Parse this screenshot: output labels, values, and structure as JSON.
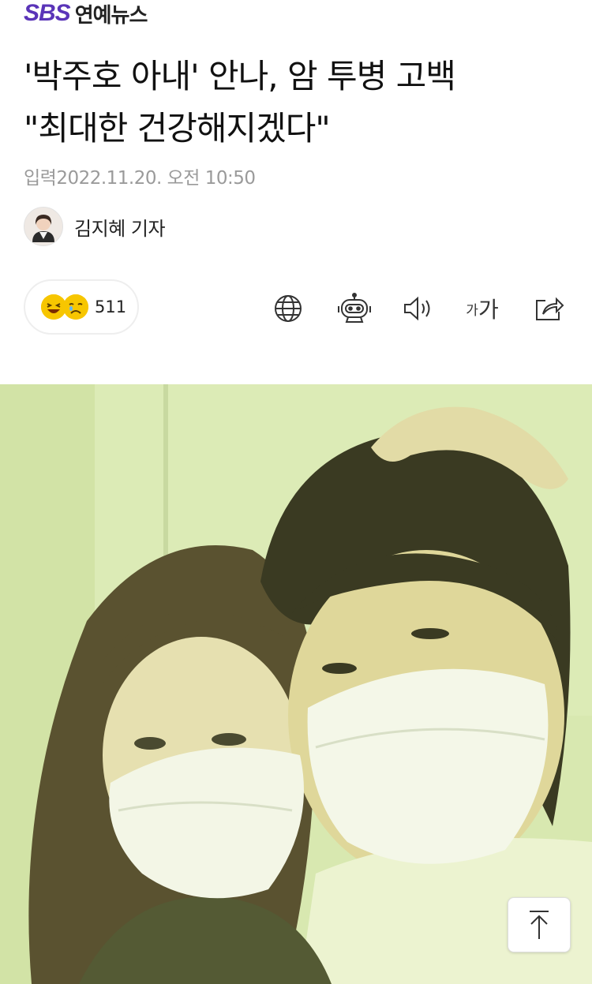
{
  "brand": {
    "logo": "SBS",
    "section": "연예뉴스"
  },
  "article": {
    "headline_line1": "'박주호 아내' 안나, 암 투병 고백",
    "headline_line2": "\"최대한 건강해지겠다\"",
    "dateline": "입력2022.11.20. 오전 10:50",
    "reporter": "김지혜 기자"
  },
  "reactions": {
    "count": "511",
    "icons": [
      "laughing-emoji",
      "crying-emoji"
    ]
  },
  "tools": {
    "font_small": "가",
    "font_large": "가",
    "icons": [
      "globe-icon",
      "robot-icon",
      "speaker-icon",
      "font-size-icon",
      "share-icon"
    ]
  },
  "colors": {
    "brand_purple": "#5a34b8",
    "emoji_yellow": "#f7c600",
    "photo_tint": "#d8e8b0"
  },
  "scroll_top": {
    "icon": "arrow-up-icon"
  }
}
